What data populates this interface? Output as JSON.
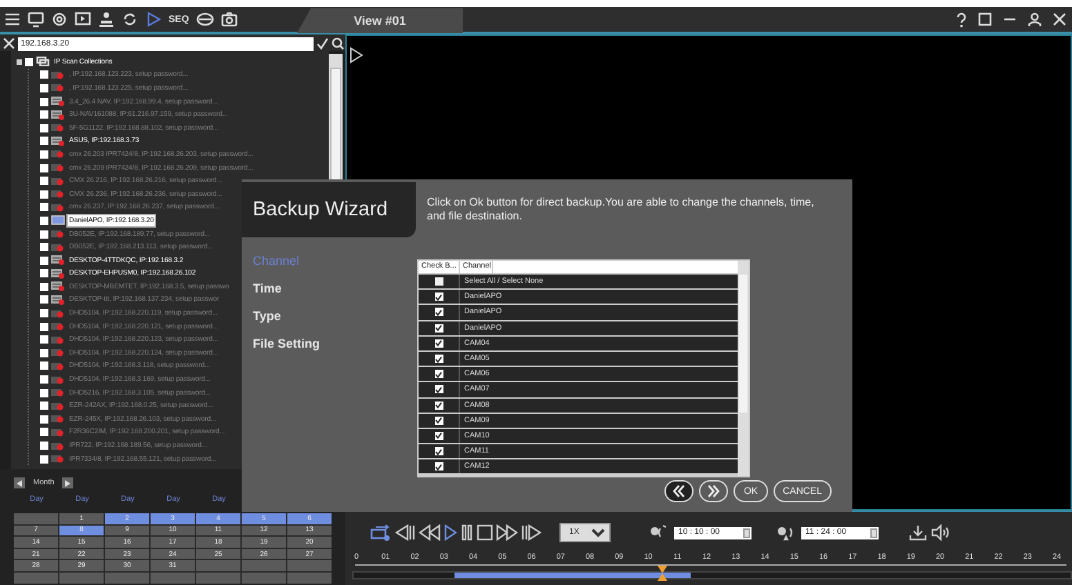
{
  "toolbar": {
    "seq_label": "SEQ"
  },
  "view_tab": {
    "title": "View #01"
  },
  "search": {
    "value": "192.168.3.20"
  },
  "tree": {
    "root": {
      "label": "IP Scan Collections",
      "checked": false,
      "children": [
        {
          "label": ", IP:192.168.123.223, setup password...",
          "kind": "camera",
          "checked": false,
          "dimmed": true,
          "selected": false
        },
        {
          "label": ", IP:192.168.123.225, setup password...",
          "kind": "camera",
          "checked": false,
          "dimmed": true,
          "selected": false
        },
        {
          "label": "3.4_26.4 NAV, IP:192.168.99.4, setup password...",
          "kind": "recorder",
          "checked": false,
          "dimmed": true,
          "selected": false
        },
        {
          "label": "3U-NAV161088, IP:61.216.97.159, setup password...",
          "kind": "recorder",
          "checked": false,
          "dimmed": true,
          "selected": false
        },
        {
          "label": "5F-5G1122, IP:192.168.88.102, setup password...",
          "kind": "camera",
          "checked": false,
          "dimmed": true,
          "selected": false
        },
        {
          "label": "ASUS, IP:192.168.3.73",
          "kind": "recorder",
          "checked": false,
          "dimmed": false,
          "selected": false
        },
        {
          "label": "cmx 26.203 IPR7424/8, IP:192.168.26.203, setup password...",
          "kind": "camera",
          "checked": false,
          "dimmed": true,
          "selected": false
        },
        {
          "label": "cmx 26.209 IPR7424/8, IP:192.168.26.209, setup password...",
          "kind": "camera",
          "checked": false,
          "dimmed": true,
          "selected": false
        },
        {
          "label": "CMX 26.216, IP:192.168.26.216, setup password...",
          "kind": "camera",
          "checked": false,
          "dimmed": true,
          "selected": false
        },
        {
          "label": "CMX 26.236, IP:192.168.26.236, setup password...",
          "kind": "camera",
          "checked": false,
          "dimmed": true,
          "selected": false
        },
        {
          "label": "cmx 26.237, IP:192.168.26.237, setup password...",
          "kind": "camera",
          "checked": false,
          "dimmed": true,
          "selected": false
        },
        {
          "label": "DanielAPO, IP:192.168.3.20",
          "kind": "monitor",
          "checked": false,
          "dimmed": false,
          "selected": true
        },
        {
          "label": "DB052E, IP:192.168.189.77, setup password...",
          "kind": "camera",
          "checked": false,
          "dimmed": true,
          "selected": false
        },
        {
          "label": "DB052E, IP:192.168.213.113, setup password...",
          "kind": "camera",
          "checked": false,
          "dimmed": true,
          "selected": false
        },
        {
          "label": "DESKTOP-4TTDKQC, IP:192.168.3.2",
          "kind": "recorder",
          "checked": false,
          "dimmed": false,
          "selected": false
        },
        {
          "label": "DESKTOP-EHPUSM0, IP:192.168.26.102",
          "kind": "recorder",
          "checked": false,
          "dimmed": false,
          "selected": false
        },
        {
          "label": "DESKTOP-MBEMTET, IP:192.168.3.5, setup passwo",
          "kind": "recorder",
          "checked": false,
          "dimmed": true,
          "selected": false
        },
        {
          "label": "DESKTOP-ttt, IP:192.168.137.234, setup passwor",
          "kind": "recorder",
          "checked": false,
          "dimmed": true,
          "selected": false
        },
        {
          "label": "DHD5104, IP:192.168.220.119, setup password...",
          "kind": "camera",
          "checked": false,
          "dimmed": true,
          "selected": false
        },
        {
          "label": "DHD5104, IP:192.168.220.121, setup password...",
          "kind": "camera",
          "checked": false,
          "dimmed": true,
          "selected": false
        },
        {
          "label": "DHD5104, IP:192.168.220.123, setup password...",
          "kind": "camera",
          "checked": false,
          "dimmed": true,
          "selected": false
        },
        {
          "label": "DHD5104, IP:192.168.220.124, setup password...",
          "kind": "camera",
          "checked": false,
          "dimmed": true,
          "selected": false
        },
        {
          "label": "DHD5104, IP:192.168.3.118, setup password...",
          "kind": "camera",
          "checked": false,
          "dimmed": true,
          "selected": false
        },
        {
          "label": "DHD5104, IP:192.168.3.169, setup password...",
          "kind": "camera",
          "checked": false,
          "dimmed": true,
          "selected": false
        },
        {
          "label": "DHD5216, IP:192.168.3.105, setup password...",
          "kind": "camera",
          "checked": false,
          "dimmed": true,
          "selected": false
        },
        {
          "label": "EZR-242AX, IP:192.168.0.25, setup password...",
          "kind": "camera",
          "checked": false,
          "dimmed": true,
          "selected": false
        },
        {
          "label": "EZR-245X, IP:192.168.26.103, setup password...",
          "kind": "camera",
          "checked": false,
          "dimmed": true,
          "selected": false
        },
        {
          "label": "F2R36C2IM, IP:192.168.200.201, setup password...",
          "kind": "camera",
          "checked": false,
          "dimmed": true,
          "selected": false
        },
        {
          "label": "IPR722, IP:192.168.189.56, setup password...",
          "kind": "camera",
          "checked": false,
          "dimmed": true,
          "selected": false
        },
        {
          "label": "IPR7334/8, IP:192.168.55.121, setup password...",
          "kind": "camera",
          "checked": false,
          "dimmed": true,
          "selected": false
        }
      ]
    }
  },
  "calendar": {
    "title": "Month",
    "weekday_headers": [
      "Day",
      "Day",
      "Day",
      "Day",
      "Day"
    ],
    "weeks": [
      [
        {
          "selected": false
        },
        {
          "label": "1",
          "selected": false
        },
        {
          "label": "2",
          "selected": true
        },
        {
          "label": "3",
          "selected": true
        },
        {
          "label": "4",
          "selected": true
        },
        {
          "label": "5",
          "selected": true
        },
        {
          "label": "6",
          "selected": true
        }
      ],
      [
        {
          "label": "7",
          "selected": false
        },
        {
          "label": "8",
          "selected": true
        },
        {
          "label": "9",
          "selected": false
        },
        {
          "label": "10",
          "selected": false
        },
        {
          "label": "11",
          "selected": false
        },
        {
          "label": "12",
          "selected": false
        },
        {
          "label": "13",
          "selected": false
        }
      ],
      [
        {
          "label": "14",
          "selected": false
        },
        {
          "label": "15",
          "selected": false
        },
        {
          "label": "16",
          "selected": false
        },
        {
          "label": "17",
          "selected": false
        },
        {
          "label": "18",
          "selected": false
        },
        {
          "label": "19",
          "selected": false
        },
        {
          "label": "20",
          "selected": false
        }
      ],
      [
        {
          "label": "21",
          "selected": false
        },
        {
          "label": "22",
          "selected": false
        },
        {
          "label": "23",
          "selected": false
        },
        {
          "label": "24",
          "selected": false
        },
        {
          "label": "25",
          "selected": false
        },
        {
          "label": "26",
          "selected": false
        },
        {
          "label": "27",
          "selected": false
        }
      ],
      [
        {
          "label": "28",
          "selected": false
        },
        {
          "label": "29",
          "selected": false
        },
        {
          "label": "30",
          "selected": false
        },
        {
          "label": "31",
          "selected": false
        },
        {
          "selected": false
        },
        {
          "selected": false
        },
        {
          "selected": false
        }
      ],
      [
        {
          "selected": false
        },
        {
          "selected": false
        },
        {
          "selected": false
        },
        {
          "selected": false
        },
        {
          "selected": false
        },
        {
          "selected": false
        },
        {
          "selected": false
        }
      ]
    ]
  },
  "dialog": {
    "title": "Backup Wizard",
    "description": "Click on Ok button for direct backup.You are able to change the channels, time, and file destination.",
    "steps": [
      {
        "label": "Channel",
        "selected": true
      },
      {
        "label": "Time",
        "selected": false
      },
      {
        "label": "Type",
        "selected": false
      },
      {
        "label": "File Setting",
        "selected": false
      }
    ],
    "table": {
      "columns": [
        "Check B...",
        "Channel"
      ],
      "rows": [
        {
          "label": "Select All / Select None",
          "checked": false
        },
        {
          "label": "DanielAPO",
          "checked": true
        },
        {
          "label": "DanielAPO",
          "checked": true
        },
        {
          "label": "DanielAPO",
          "checked": true
        },
        {
          "label": "CAM04",
          "checked": true
        },
        {
          "label": "CAM05",
          "checked": true
        },
        {
          "label": "CAM06",
          "checked": true
        },
        {
          "label": "CAM07",
          "checked": true
        },
        {
          "label": "CAM08",
          "checked": true
        },
        {
          "label": "CAM09",
          "checked": true
        },
        {
          "label": "CAM10",
          "checked": true
        },
        {
          "label": "CAM11",
          "checked": true
        },
        {
          "label": "CAM12",
          "checked": true
        }
      ]
    },
    "buttons": [
      {
        "kind": "back",
        "disabled": true
      },
      {
        "kind": "next",
        "disabled": false
      },
      {
        "kind": "text",
        "label": "OK",
        "disabled": false
      },
      {
        "kind": "text",
        "label": "CANCEL",
        "disabled": false
      }
    ]
  },
  "playback": {
    "speed": "1X",
    "start_time": "10 : 10 : 00",
    "end_time": "11 : 24 : 00",
    "hours": [
      "0",
      "01",
      "02",
      "03",
      "04",
      "05",
      "06",
      "07",
      "08",
      "09",
      "10",
      "11",
      "12",
      "13",
      "14",
      "15",
      "16",
      "17",
      "18",
      "19",
      "20",
      "21",
      "22",
      "23",
      "24"
    ],
    "recording": {
      "unrecorded_lead": {
        "level": 0.14
      },
      "recorded_until": {
        "level": 0.47
      }
    },
    "playhead": {
      "level": 0.43
    }
  }
}
